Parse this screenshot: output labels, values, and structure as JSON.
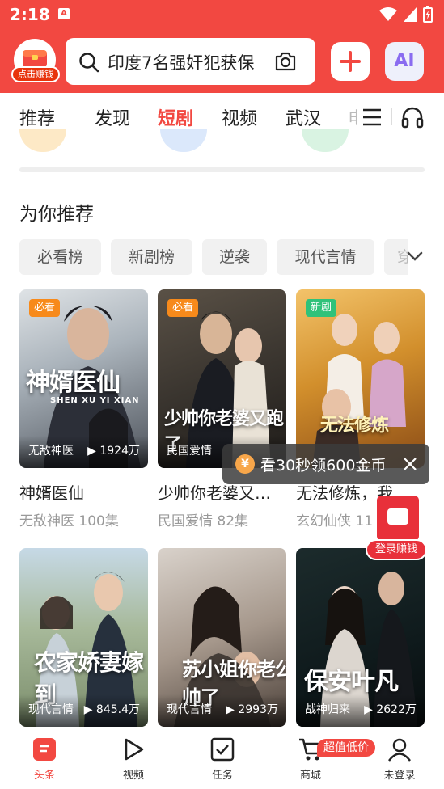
{
  "status": {
    "time": "2:18",
    "notif_icon": "A"
  },
  "header": {
    "logo_tag": "点击赚钱",
    "search_text": "印度7名强奸犯获保",
    "ai_label": "AI"
  },
  "tabs": [
    "推荐",
    "发现",
    "短剧",
    "视频",
    "武汉",
    "电"
  ],
  "section_title": "为你推荐",
  "chips": [
    "必看榜",
    "新剧榜",
    "逆袭",
    "现代言情",
    "穿"
  ],
  "cards": [
    {
      "badge": "必看",
      "title": "神婿医仙",
      "subtitle": "SHEN XU YI XIAN",
      "genre": "无敌神医",
      "views": "1924万",
      "name": "神婿医仙",
      "meta": "无敌神医  100集"
    },
    {
      "badge": "必看",
      "title": "少帅你老婆又跑了",
      "genre": "民国爱情",
      "views": "",
      "name": "少帅你老婆又…",
      "meta": "民国爱情  82集"
    },
    {
      "badge": "新剧",
      "title": "无法修炼",
      "genre": "",
      "views": "",
      "name": "无法修炼，我",
      "meta": "玄幻仙侠  11"
    },
    {
      "badge": "",
      "title": "农家娇妻嫁到",
      "genre": "现代言情",
      "views": "845.4万",
      "name": "",
      "meta": ""
    },
    {
      "badge": "",
      "title": "苏小姐你老公帅了",
      "genre": "现代言情",
      "views": "2993万",
      "name": "",
      "meta": ""
    },
    {
      "badge": "",
      "title": "保安叶凡",
      "genre": "战神归来",
      "views": "2622万",
      "name": "",
      "meta": ""
    }
  ],
  "popup": {
    "coin_symbol": "¥",
    "text": "看30秒领600金币",
    "login_earn": "登录赚钱"
  },
  "bottom_nav": {
    "items": [
      "头条",
      "视频",
      "任务",
      "商城",
      "未登录"
    ],
    "promo": "超值低价"
  },
  "colors": {
    "brand": "#f24841",
    "chip_bg": "#f1f1f1"
  }
}
